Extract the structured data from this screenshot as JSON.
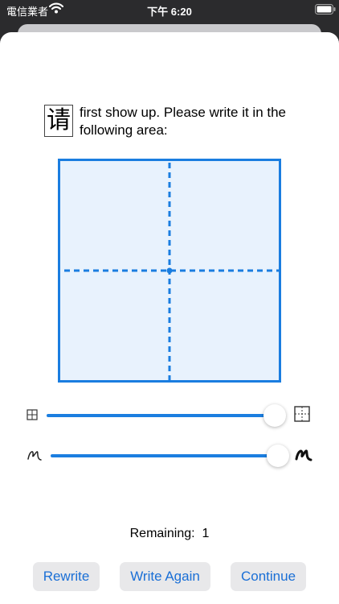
{
  "status_bar": {
    "carrier": "電信業者",
    "time": "下午 6:20",
    "wifi_icon": "wifi-icon",
    "battery_icon": "battery-icon"
  },
  "prompt": {
    "character": "请",
    "text": "first show up. Please write it in the following area:"
  },
  "colors": {
    "accent": "#1a7de0",
    "pad_background": "#e8f2fd",
    "button_background": "#e8e8ea",
    "button_text": "#1a6fd6"
  },
  "sliders": {
    "grid_size": {
      "value": 1.0,
      "min_icon": "small-grid-icon",
      "max_icon": "large-grid-icon"
    },
    "stroke_width": {
      "value": 1.0,
      "min_icon": "thin-stroke-icon",
      "max_icon": "thick-stroke-icon"
    }
  },
  "remaining": {
    "label": "Remaining:",
    "count": "1"
  },
  "buttons": {
    "rewrite": "Rewrite",
    "write_again": "Write Again",
    "continue": "Continue"
  }
}
